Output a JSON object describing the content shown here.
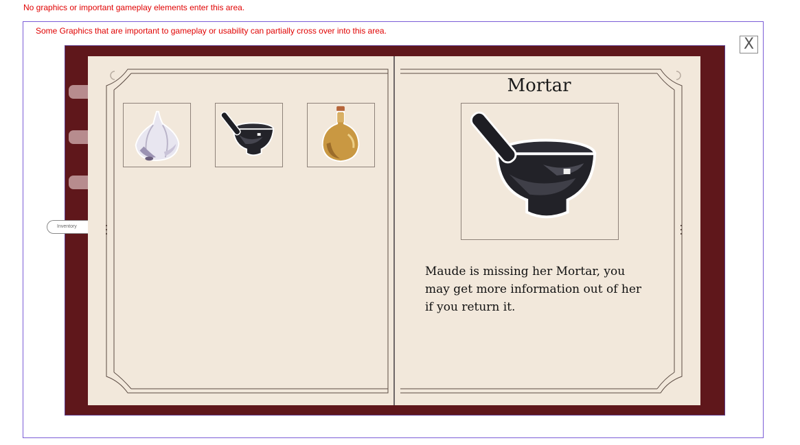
{
  "notes": {
    "outer": "No graphics or important gameplay elements enter this area.",
    "inner": "Some Graphics that are important to gameplay or usability can partially cross over into this area."
  },
  "close_button": {
    "label": "X"
  },
  "side_tabs": [
    {
      "name": "tab-1"
    },
    {
      "name": "tab-2"
    },
    {
      "name": "tab-3"
    }
  ],
  "inventory_tab": {
    "label": "Inventory"
  },
  "inventory_items": [
    {
      "name": "garlic",
      "icon": "garlic-icon"
    },
    {
      "name": "mortar",
      "icon": "mortar-and-pestle-icon"
    },
    {
      "name": "potion",
      "icon": "potion-bottle-icon"
    }
  ],
  "detail": {
    "title": "Mortar",
    "description": "Maude is missing her Mortar, you may get more information out of her if you return it.",
    "icon": "mortar-and-pestle-icon"
  },
  "colors": {
    "book_cover": "#5f171b",
    "page": "#f2e8db",
    "note_text": "#e00000",
    "safe_frame": "#7a5bd6"
  }
}
